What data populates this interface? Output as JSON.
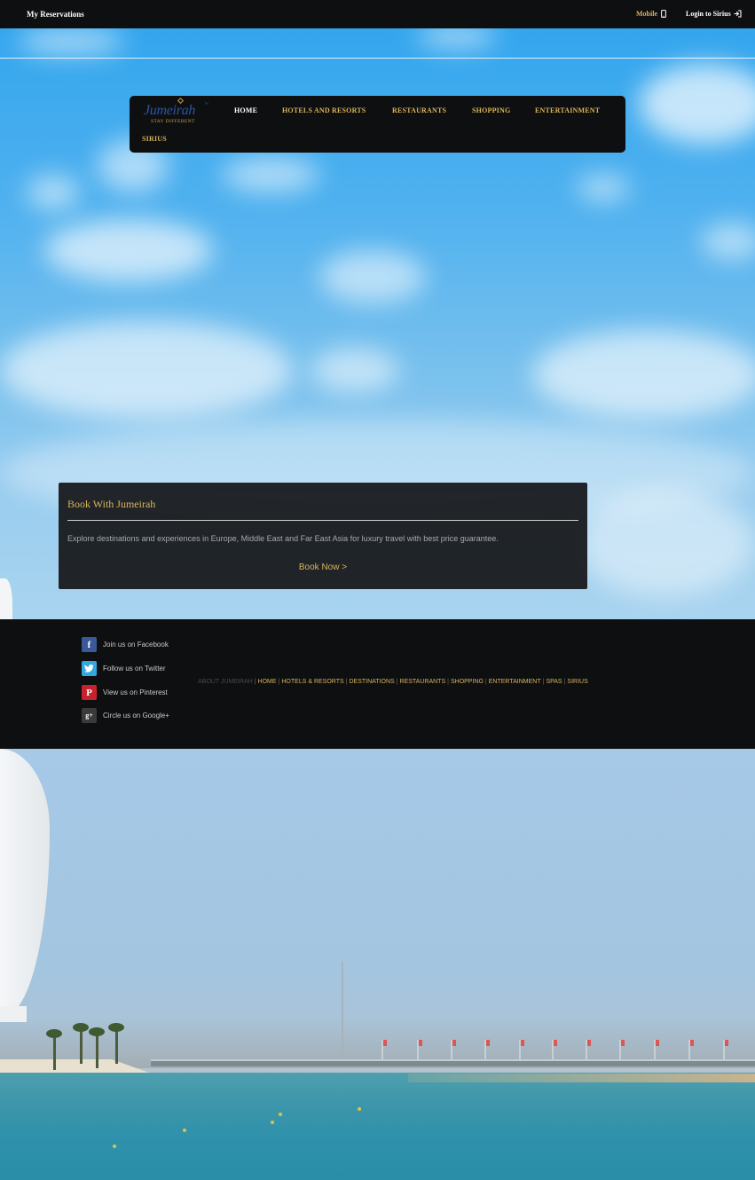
{
  "topbar": {
    "reservations": "My Reservations",
    "mobile": "Mobile",
    "login": "Login to Sirius"
  },
  "logo": {
    "wordmark": "Jumeirah",
    "tagline": "STAY DIFFERENT"
  },
  "nav": {
    "items": [
      "HOME",
      "HOTELS AND RESORTS",
      "RESTAURANTS",
      "SHOPPING",
      "ENTERTAINMENT",
      "SIRIUS"
    ],
    "active": "HOME"
  },
  "booking": {
    "title": "Book With Jumeirah",
    "description": "Explore destinations and experiences in Europe, Middle East and Far East Asia for luxury travel with best price guarantee.",
    "cta": "Book Now >"
  },
  "footer": {
    "social": [
      {
        "label": "Join us on Facebook",
        "icon": "facebook-icon",
        "color": "#3b5998",
        "glyph": "f"
      },
      {
        "label": "Follow us on Twitter",
        "icon": "twitter-icon",
        "color": "#33a8e0",
        "glyph": "t"
      },
      {
        "label": "View us on Pinterest",
        "icon": "pinterest-icon",
        "color": "#c8232c",
        "glyph": "P"
      },
      {
        "label": "Circle us on Google+",
        "icon": "google-plus-icon",
        "color": "#3a3a3a",
        "glyph": "g+"
      }
    ],
    "links_lead": "ABOUT JUMEIRAH",
    "links": [
      "HOME",
      "HOTELS & RESORTS",
      "DESTINATIONS",
      "RESTAURANTS",
      "SHOPPING",
      "ENTERTAINMENT",
      "SPAS",
      "SIRIUS"
    ]
  },
  "colors": {
    "accent_gold": "#d9b35b",
    "bar_black": "#0e0f10",
    "logo_blue": "#2a56a3"
  }
}
